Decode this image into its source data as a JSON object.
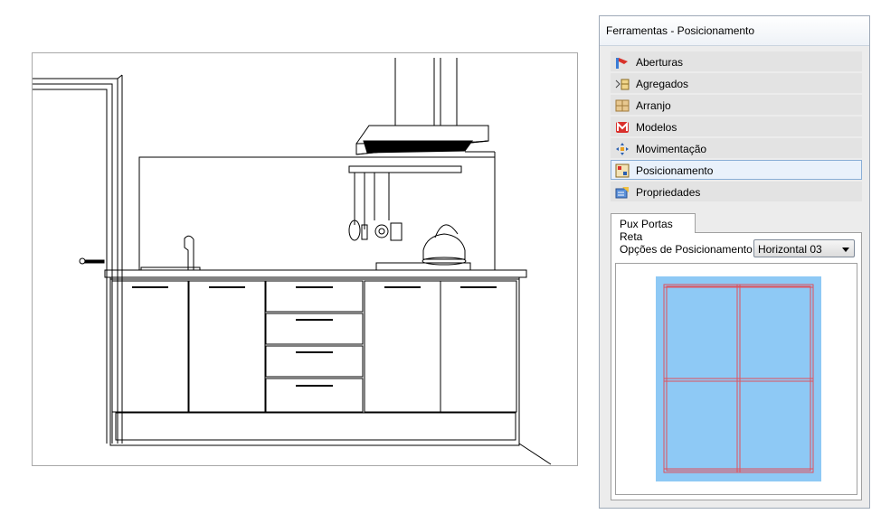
{
  "panel": {
    "title": "Ferramentas - Posicionamento",
    "items": [
      {
        "label": "Aberturas",
        "icon": "aberturas-icon"
      },
      {
        "label": "Agregados",
        "icon": "agregados-icon"
      },
      {
        "label": "Arranjo",
        "icon": "arranjo-icon"
      },
      {
        "label": "Modelos",
        "icon": "modelos-icon"
      },
      {
        "label": "Movimentação",
        "icon": "movimentacao-icon"
      },
      {
        "label": "Posicionamento",
        "icon": "posicionamento-icon",
        "selected": true
      },
      {
        "label": "Propriedades",
        "icon": "propriedades-icon"
      }
    ],
    "tab": {
      "label": "Pux Portas Reta",
      "options_label": "Opções de Posicionamento",
      "options_value": "Horizontal 03"
    }
  },
  "colors": {
    "selection_border": "#8aaed6",
    "preview_fill": "#8ec9f5",
    "preview_lines": "#e0505a"
  }
}
